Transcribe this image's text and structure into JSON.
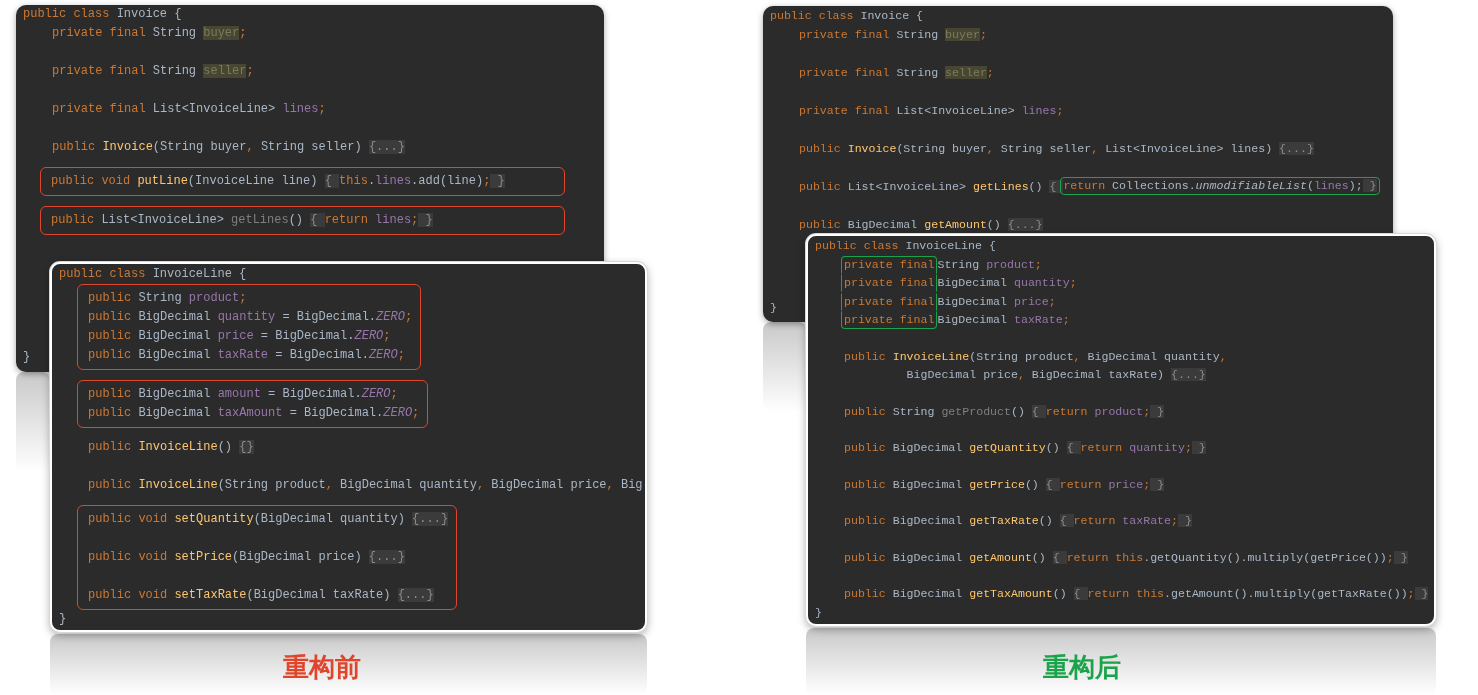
{
  "panels": [
    {
      "caption": "重构前",
      "color": "#e0452c",
      "windows": [
        {
          "kind": "back",
          "blocks": [
            {
              "boxed": false,
              "lines": [
                {
                  "tokens": [
                    {
                      "text": "public class ",
                      "kind": "kw"
                    },
                    {
                      "text": "Invoice {",
                      "kind": "tx"
                    }
                  ]
                },
                {
                  "indent": true,
                  "tokens": [
                    {
                      "text": "private final ",
                      "kind": "kw"
                    },
                    {
                      "text": "String ",
                      "kind": "tx"
                    },
                    {
                      "text": "buyer",
                      "kind": "hl"
                    },
                    {
                      "text": ";",
                      "kind": "kw"
                    }
                  ]
                },
                {
                  "indent": true,
                  "space_before": true,
                  "tokens": [
                    {
                      "text": "private final ",
                      "kind": "kw"
                    },
                    {
                      "text": "String ",
                      "kind": "tx"
                    },
                    {
                      "text": "seller",
                      "kind": "hl"
                    },
                    {
                      "text": ";",
                      "kind": "kw"
                    }
                  ]
                },
                {
                  "indent": true,
                  "space_before": true,
                  "tokens": [
                    {
                      "text": "private final ",
                      "kind": "kw"
                    },
                    {
                      "text": "List<InvoiceLine> ",
                      "kind": "tx"
                    },
                    {
                      "text": "lines",
                      "kind": "fd"
                    },
                    {
                      "text": ";",
                      "kind": "kw"
                    }
                  ]
                },
                {
                  "indent": true,
                  "space_before": true,
                  "tokens": [
                    {
                      "text": "public ",
                      "kind": "kw"
                    },
                    {
                      "text": "Invoice",
                      "kind": "fn"
                    },
                    {
                      "text": "(String buyer",
                      "kind": "tx"
                    },
                    {
                      "text": ", ",
                      "kind": "kw"
                    },
                    {
                      "text": "String seller) ",
                      "kind": "tx"
                    },
                    {
                      "text": "{...}",
                      "kind": "fold"
                    }
                  ]
                }
              ]
            },
            {
              "boxed": true,
              "space_before": true,
              "lines": [
                {
                  "tokens": [
                    {
                      "text": "public void ",
                      "kind": "kw"
                    },
                    {
                      "text": "putLine",
                      "kind": "fn"
                    },
                    {
                      "text": "(InvoiceLine line) ",
                      "kind": "tx"
                    },
                    {
                      "text": "{ ",
                      "kind": "fold"
                    },
                    {
                      "text": "this",
                      "kind": "kw"
                    },
                    {
                      "text": ".",
                      "kind": "tx"
                    },
                    {
                      "text": "lines",
                      "kind": "fd"
                    },
                    {
                      "text": ".add(line)",
                      "kind": "tx"
                    },
                    {
                      "text": ";",
                      "kind": "kw"
                    },
                    {
                      "text": " }",
                      "kind": "fold"
                    }
                  ]
                }
              ]
            },
            {
              "boxed": true,
              "space_before": true,
              "lines": [
                {
                  "tokens": [
                    {
                      "text": "public ",
                      "kind": "kw"
                    },
                    {
                      "text": "List<InvoiceLine> ",
                      "kind": "tx"
                    },
                    {
                      "text": "getLines",
                      "kind": "dim"
                    },
                    {
                      "text": "() ",
                      "kind": "tx"
                    },
                    {
                      "text": "{ ",
                      "kind": "fold"
                    },
                    {
                      "text": "return ",
                      "kind": "kw"
                    },
                    {
                      "text": "lines",
                      "kind": "fd"
                    },
                    {
                      "text": ";",
                      "kind": "kw"
                    },
                    {
                      "text": " }",
                      "kind": "fold"
                    }
                  ]
                }
              ]
            },
            {
              "boxed": false,
              "lines": [
                {
                  "tokens": [
                    {
                      "text": "}",
                      "kind": "tx"
                    }
                  ]
                }
              ]
            }
          ]
        },
        {
          "kind": "front",
          "blocks": [
            {
              "boxed": false,
              "lines": [
                {
                  "tokens": [
                    {
                      "text": "public class ",
                      "kind": "kw"
                    },
                    {
                      "text": "InvoiceLine {",
                      "kind": "tx"
                    }
                  ]
                }
              ]
            },
            {
              "boxed": true,
              "lines": [
                {
                  "tokens": [
                    {
                      "text": "public ",
                      "kind": "kw"
                    },
                    {
                      "text": "String ",
                      "kind": "tx"
                    },
                    {
                      "text": "product",
                      "kind": "fd"
                    },
                    {
                      "text": ";",
                      "kind": "kw"
                    }
                  ]
                },
                {
                  "tokens": [
                    {
                      "text": "public ",
                      "kind": "kw"
                    },
                    {
                      "text": "BigDecimal ",
                      "kind": "tx"
                    },
                    {
                      "text": "quantity",
                      "kind": "fd"
                    },
                    {
                      "text": " = BigDecimal.",
                      "kind": "tx"
                    },
                    {
                      "text": "ZERO",
                      "kind": "it"
                    },
                    {
                      "text": ";",
                      "kind": "kw"
                    }
                  ]
                },
                {
                  "tokens": [
                    {
                      "text": "public ",
                      "kind": "kw"
                    },
                    {
                      "text": "BigDecimal ",
                      "kind": "tx"
                    },
                    {
                      "text": "price",
                      "kind": "fd"
                    },
                    {
                      "text": " = BigDecimal.",
                      "kind": "tx"
                    },
                    {
                      "text": "ZERO",
                      "kind": "it"
                    },
                    {
                      "text": ";",
                      "kind": "kw"
                    }
                  ]
                },
                {
                  "tokens": [
                    {
                      "text": "public ",
                      "kind": "kw"
                    },
                    {
                      "text": "BigDecimal ",
                      "kind": "tx"
                    },
                    {
                      "text": "taxRate",
                      "kind": "fd"
                    },
                    {
                      "text": " = BigDecimal.",
                      "kind": "tx"
                    },
                    {
                      "text": "ZERO",
                      "kind": "it"
                    },
                    {
                      "text": ";",
                      "kind": "kw"
                    }
                  ]
                }
              ]
            },
            {
              "boxed": true,
              "space_before": true,
              "lines": [
                {
                  "tokens": [
                    {
                      "text": "public ",
                      "kind": "kw"
                    },
                    {
                      "text": "BigDecimal ",
                      "kind": "tx"
                    },
                    {
                      "text": "amount",
                      "kind": "fd"
                    },
                    {
                      "text": " = BigDecimal.",
                      "kind": "tx"
                    },
                    {
                      "text": "ZERO",
                      "kind": "it"
                    },
                    {
                      "text": ";",
                      "kind": "kw"
                    }
                  ]
                },
                {
                  "tokens": [
                    {
                      "text": "public ",
                      "kind": "kw"
                    },
                    {
                      "text": "BigDecimal ",
                      "kind": "tx"
                    },
                    {
                      "text": "taxAmount",
                      "kind": "fd"
                    },
                    {
                      "text": " = BigDecimal.",
                      "kind": "tx"
                    },
                    {
                      "text": "ZERO",
                      "kind": "it"
                    },
                    {
                      "text": ";",
                      "kind": "kw"
                    }
                  ]
                }
              ]
            },
            {
              "boxed": false,
              "lines": [
                {
                  "indent": true,
                  "space_before": true,
                  "tokens": [
                    {
                      "text": "public ",
                      "kind": "kw"
                    },
                    {
                      "text": "InvoiceLine",
                      "kind": "fn"
                    },
                    {
                      "text": "() ",
                      "kind": "tx"
                    },
                    {
                      "text": "{}",
                      "kind": "fold"
                    }
                  ]
                },
                {
                  "indent": true,
                  "space_before": true,
                  "tokens": [
                    {
                      "text": "public ",
                      "kind": "kw"
                    },
                    {
                      "text": "InvoiceLine",
                      "kind": "fn"
                    },
                    {
                      "text": "(String product",
                      "kind": "tx"
                    },
                    {
                      "text": ", ",
                      "kind": "kw"
                    },
                    {
                      "text": "BigDecimal quantity",
                      "kind": "tx"
                    },
                    {
                      "text": ", ",
                      "kind": "kw"
                    },
                    {
                      "text": "BigDecimal price",
                      "kind": "tx"
                    },
                    {
                      "text": ", ",
                      "kind": "kw"
                    },
                    {
                      "text": "Big",
                      "kind": "tx"
                    }
                  ]
                }
              ]
            },
            {
              "boxed": true,
              "space_before": true,
              "lines": [
                {
                  "tokens": [
                    {
                      "text": "public void ",
                      "kind": "kw"
                    },
                    {
                      "text": "setQuantity",
                      "kind": "fn"
                    },
                    {
                      "text": "(BigDecimal quantity) ",
                      "kind": "tx"
                    },
                    {
                      "text": "{...}",
                      "kind": "fold"
                    }
                  ]
                },
                {
                  "space_before": true,
                  "tokens": [
                    {
                      "text": "public void ",
                      "kind": "kw"
                    },
                    {
                      "text": "setPrice",
                      "kind": "fn"
                    },
                    {
                      "text": "(BigDecimal price) ",
                      "kind": "tx"
                    },
                    {
                      "text": "{...}",
                      "kind": "fold"
                    }
                  ]
                },
                {
                  "space_before": true,
                  "tokens": [
                    {
                      "text": "public void ",
                      "kind": "kw"
                    },
                    {
                      "text": "setTaxRate",
                      "kind": "fn"
                    },
                    {
                      "text": "(BigDecimal taxRate) ",
                      "kind": "tx"
                    },
                    {
                      "text": "{...}",
                      "kind": "fold"
                    }
                  ]
                }
              ]
            },
            {
              "boxed": false,
              "lines": [
                {
                  "tokens": [
                    {
                      "text": "}",
                      "kind": "tx"
                    }
                  ]
                }
              ]
            }
          ]
        }
      ]
    },
    {
      "caption": "重构后",
      "color": "#1aa34a",
      "windows": [
        {
          "kind": "back",
          "blocks": [
            {
              "boxed": false,
              "lines": [
                {
                  "tokens": [
                    {
                      "text": "public class ",
                      "kind": "kw"
                    },
                    {
                      "text": "Invoice {",
                      "kind": "tx"
                    }
                  ]
                },
                {
                  "indent": true,
                  "tokens": [
                    {
                      "text": "private final ",
                      "kind": "kw"
                    },
                    {
                      "text": "String ",
                      "kind": "tx"
                    },
                    {
                      "text": "buyer",
                      "kind": "hl"
                    },
                    {
                      "text": ";",
                      "kind": "kw"
                    }
                  ]
                },
                {
                  "indent": true,
                  "space_before": true,
                  "tokens": [
                    {
                      "text": "private final ",
                      "kind": "kw"
                    },
                    {
                      "text": "String ",
                      "kind": "tx"
                    },
                    {
                      "text": "seller",
                      "kind": "hl"
                    },
                    {
                      "text": ";",
                      "kind": "kw"
                    }
                  ]
                },
                {
                  "indent": true,
                  "space_before": true,
                  "tokens": [
                    {
                      "text": "private final ",
                      "kind": "kw"
                    },
                    {
                      "text": "List<InvoiceLine> ",
                      "kind": "tx"
                    },
                    {
                      "text": "lines",
                      "kind": "fd"
                    },
                    {
                      "text": ";",
                      "kind": "kw"
                    }
                  ]
                },
                {
                  "indent": true,
                  "space_before": true,
                  "tokens": [
                    {
                      "text": "public ",
                      "kind": "kw"
                    },
                    {
                      "text": "Invoice",
                      "kind": "fn"
                    },
                    {
                      "text": "(String buyer",
                      "kind": "tx"
                    },
                    {
                      "text": ", ",
                      "kind": "kw"
                    },
                    {
                      "text": "String seller",
                      "kind": "tx"
                    },
                    {
                      "text": ", ",
                      "kind": "kw"
                    },
                    {
                      "text": "List<InvoiceLine> lines) ",
                      "kind": "tx"
                    },
                    {
                      "text": "{...}",
                      "kind": "fold"
                    }
                  ]
                },
                {
                  "indent": true,
                  "space_before": true,
                  "tokens": [
                    {
                      "text": "public ",
                      "kind": "kw"
                    },
                    {
                      "text": "List<InvoiceLine> ",
                      "kind": "tx"
                    },
                    {
                      "text": "getLines",
                      "kind": "fn"
                    },
                    {
                      "text": "() ",
                      "kind": "tx"
                    },
                    {
                      "text": "{ ",
                      "kind": "fold"
                    },
                    {
                      "text": "return ",
                      "kind": "kw",
                      "boxed": true
                    },
                    {
                      "text": "Collections.",
                      "kind": "tx",
                      "boxed": true
                    },
                    {
                      "text": "unmodifiableList",
                      "kind": "itx",
                      "boxed": true
                    },
                    {
                      "text": "(",
                      "kind": "tx",
                      "boxed": true
                    },
                    {
                      "text": "lines",
                      "kind": "fd",
                      "boxed": true
                    },
                    {
                      "text": ");",
                      "kind": "tx",
                      "boxed": true
                    },
                    {
                      "text": " }",
                      "kind": "fold",
                      "boxed": true
                    }
                  ]
                },
                {
                  "indent": true,
                  "space_before": true,
                  "tokens": [
                    {
                      "text": "public ",
                      "kind": "kw"
                    },
                    {
                      "text": "BigDecimal ",
                      "kind": "tx"
                    },
                    {
                      "text": "getAmount",
                      "kind": "fn"
                    },
                    {
                      "text": "() ",
                      "kind": "tx"
                    },
                    {
                      "text": "{...}",
                      "kind": "fold"
                    }
                  ]
                }
              ]
            },
            {
              "boxed": false,
              "lines": [
                {
                  "tokens": [
                    {
                      "text": "}",
                      "kind": "tx"
                    }
                  ]
                }
              ]
            }
          ]
        },
        {
          "kind": "front",
          "blocks": [
            {
              "boxed": false,
              "lines": [
                {
                  "tokens": [
                    {
                      "text": "public class ",
                      "kind": "kw"
                    },
                    {
                      "text": "InvoiceLine {",
                      "kind": "tx"
                    }
                  ]
                },
                {
                  "indent": true,
                  "tokens": [
                    {
                      "text": "private final",
                      "kind": "kw",
                      "boxed": true
                    },
                    {
                      "text": "String ",
                      "kind": "tx"
                    },
                    {
                      "text": "product",
                      "kind": "fd"
                    },
                    {
                      "text": ";",
                      "kind": "kw"
                    }
                  ]
                },
                {
                  "indent": true,
                  "tokens": [
                    {
                      "text": "private final",
                      "kind": "kw",
                      "boxed": true
                    },
                    {
                      "text": "BigDecimal ",
                      "kind": "tx"
                    },
                    {
                      "text": "quantity",
                      "kind": "fd"
                    },
                    {
                      "text": ";",
                      "kind": "kw"
                    }
                  ]
                },
                {
                  "indent": true,
                  "tokens": [
                    {
                      "text": "private final",
                      "kind": "kw",
                      "boxed": true
                    },
                    {
                      "text": "BigDecimal ",
                      "kind": "tx"
                    },
                    {
                      "text": "price",
                      "kind": "fd"
                    },
                    {
                      "text": ";",
                      "kind": "kw"
                    }
                  ]
                },
                {
                  "indent": true,
                  "tokens": [
                    {
                      "text": "private final",
                      "kind": "kw",
                      "boxed": true
                    },
                    {
                      "text": "BigDecimal ",
                      "kind": "tx"
                    },
                    {
                      "text": "taxRate",
                      "kind": "fd"
                    },
                    {
                      "text": ";",
                      "kind": "kw"
                    }
                  ]
                },
                {
                  "indent": true,
                  "space_before": true,
                  "tokens": [
                    {
                      "text": "public ",
                      "kind": "kw"
                    },
                    {
                      "text": "InvoiceLine",
                      "kind": "fn"
                    },
                    {
                      "text": "(String product",
                      "kind": "tx"
                    },
                    {
                      "text": ", ",
                      "kind": "kw"
                    },
                    {
                      "text": "BigDecimal quantity",
                      "kind": "tx"
                    },
                    {
                      "text": ",",
                      "kind": "kw"
                    }
                  ]
                },
                {
                  "indent": true,
                  "tokens": [
                    {
                      "text": "         BigDecimal price",
                      "kind": "tx"
                    },
                    {
                      "text": ", ",
                      "kind": "kw"
                    },
                    {
                      "text": "BigDecimal taxRate) ",
                      "kind": "tx"
                    },
                    {
                      "text": "{...}",
                      "kind": "fold"
                    }
                  ]
                },
                {
                  "indent": true,
                  "space_before": true,
                  "tokens": [
                    {
                      "text": "public ",
                      "kind": "kw"
                    },
                    {
                      "text": "String ",
                      "kind": "tx"
                    },
                    {
                      "text": "getProduct",
                      "kind": "dim"
                    },
                    {
                      "text": "() ",
                      "kind": "tx"
                    },
                    {
                      "text": "{ ",
                      "kind": "fold"
                    },
                    {
                      "text": "return ",
                      "kind": "kw"
                    },
                    {
                      "text": "product",
                      "kind": "fd"
                    },
                    {
                      "text": ";",
                      "kind": "kw"
                    },
                    {
                      "text": " }",
                      "kind": "fold"
                    }
                  ]
                },
                {
                  "indent": true,
                  "space_before": true,
                  "tokens": [
                    {
                      "text": "public ",
                      "kind": "kw"
                    },
                    {
                      "text": "BigDecimal ",
                      "kind": "tx"
                    },
                    {
                      "text": "getQuantity",
                      "kind": "fn"
                    },
                    {
                      "text": "() ",
                      "kind": "tx"
                    },
                    {
                      "text": "{ ",
                      "kind": "fold"
                    },
                    {
                      "text": "return ",
                      "kind": "kw"
                    },
                    {
                      "text": "quantity",
                      "kind": "fd"
                    },
                    {
                      "text": ";",
                      "kind": "kw"
                    },
                    {
                      "text": " }",
                      "kind": "fold"
                    }
                  ]
                },
                {
                  "indent": true,
                  "space_before": true,
                  "tokens": [
                    {
                      "text": "public ",
                      "kind": "kw"
                    },
                    {
                      "text": "BigDecimal ",
                      "kind": "tx"
                    },
                    {
                      "text": "getPrice",
                      "kind": "fn"
                    },
                    {
                      "text": "() ",
                      "kind": "tx"
                    },
                    {
                      "text": "{ ",
                      "kind": "fold"
                    },
                    {
                      "text": "return ",
                      "kind": "kw"
                    },
                    {
                      "text": "price",
                      "kind": "fd"
                    },
                    {
                      "text": ";",
                      "kind": "kw"
                    },
                    {
                      "text": " }",
                      "kind": "fold"
                    }
                  ]
                },
                {
                  "indent": true,
                  "space_before": true,
                  "tokens": [
                    {
                      "text": "public ",
                      "kind": "kw"
                    },
                    {
                      "text": "BigDecimal ",
                      "kind": "tx"
                    },
                    {
                      "text": "getTaxRate",
                      "kind": "fn"
                    },
                    {
                      "text": "() ",
                      "kind": "tx"
                    },
                    {
                      "text": "{ ",
                      "kind": "fold"
                    },
                    {
                      "text": "return ",
                      "kind": "kw"
                    },
                    {
                      "text": "taxRate",
                      "kind": "fd"
                    },
                    {
                      "text": ";",
                      "kind": "kw"
                    },
                    {
                      "text": " }",
                      "kind": "fold"
                    }
                  ]
                },
                {
                  "indent": true,
                  "space_before": true,
                  "tokens": [
                    {
                      "text": "public ",
                      "kind": "kw"
                    },
                    {
                      "text": "BigDecimal ",
                      "kind": "tx"
                    },
                    {
                      "text": "getAmount",
                      "kind": "fn"
                    },
                    {
                      "text": "() ",
                      "kind": "tx"
                    },
                    {
                      "text": "{ ",
                      "kind": "fold"
                    },
                    {
                      "text": "return ",
                      "kind": "kw"
                    },
                    {
                      "text": "this",
                      "kind": "kw"
                    },
                    {
                      "text": ".getQuantity().multiply(getPrice())",
                      "kind": "tx"
                    },
                    {
                      "text": ";",
                      "kind": "kw"
                    },
                    {
                      "text": " }",
                      "kind": "fold"
                    }
                  ]
                },
                {
                  "indent": true,
                  "space_before": true,
                  "tokens": [
                    {
                      "text": "public ",
                      "kind": "kw"
                    },
                    {
                      "text": "BigDecimal ",
                      "kind": "tx"
                    },
                    {
                      "text": "getTaxAmount",
                      "kind": "fn"
                    },
                    {
                      "text": "() ",
                      "kind": "tx"
                    },
                    {
                      "text": "{ ",
                      "kind": "fold"
                    },
                    {
                      "text": "return ",
                      "kind": "kw"
                    },
                    {
                      "text": "this",
                      "kind": "kw"
                    },
                    {
                      "text": ".getAmount().multiply(getTaxRate())",
                      "kind": "tx"
                    },
                    {
                      "text": ";",
                      "kind": "kw"
                    },
                    {
                      "text": " }",
                      "kind": "fold"
                    }
                  ]
                },
                {
                  "tokens": [
                    {
                      "text": "}",
                      "kind": "tx"
                    }
                  ]
                }
              ]
            }
          ]
        }
      ]
    }
  ]
}
